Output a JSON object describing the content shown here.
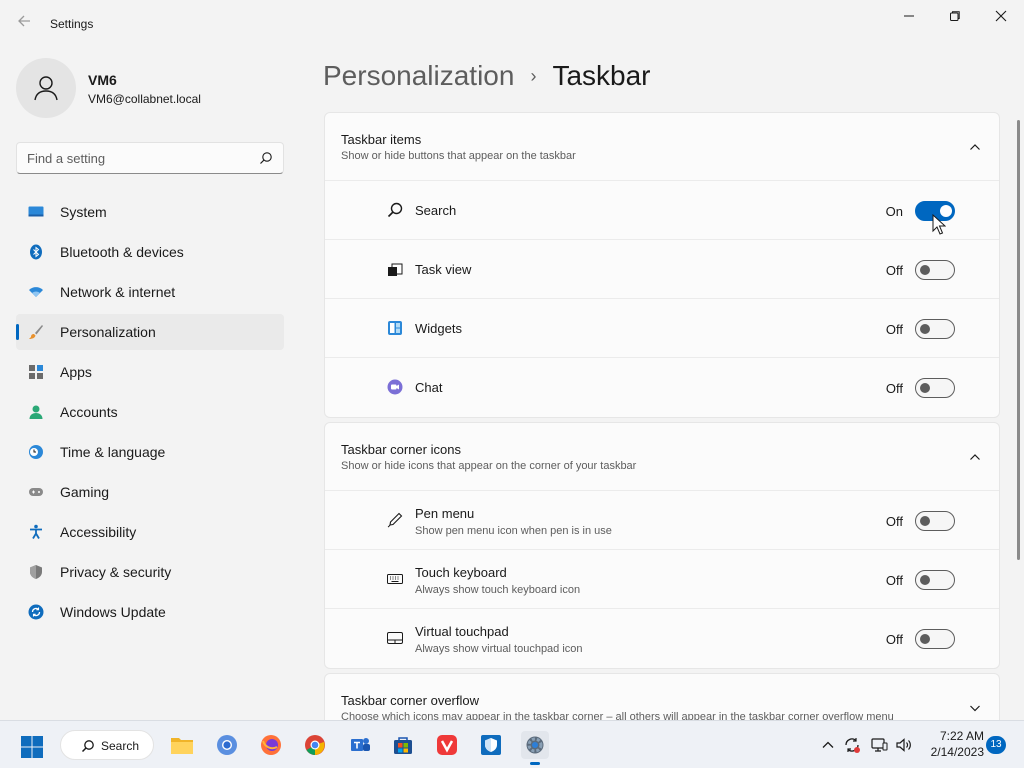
{
  "window": {
    "title": "Settings"
  },
  "user": {
    "name": "VM6",
    "email": "VM6@collabnet.local"
  },
  "search": {
    "placeholder": "Find a setting"
  },
  "sidebar": {
    "items": [
      {
        "label": "System",
        "icon": "monitor-icon"
      },
      {
        "label": "Bluetooth & devices",
        "icon": "bluetooth-icon"
      },
      {
        "label": "Network & internet",
        "icon": "wifi-icon"
      },
      {
        "label": "Personalization",
        "icon": "brush-icon",
        "selected": true
      },
      {
        "label": "Apps",
        "icon": "apps-icon"
      },
      {
        "label": "Accounts",
        "icon": "accounts-icon"
      },
      {
        "label": "Time & language",
        "icon": "clock-globe-icon"
      },
      {
        "label": "Gaming",
        "icon": "gamepad-icon"
      },
      {
        "label": "Accessibility",
        "icon": "accessibility-icon"
      },
      {
        "label": "Privacy & security",
        "icon": "shield-icon"
      },
      {
        "label": "Windows Update",
        "icon": "update-icon"
      }
    ]
  },
  "breadcrumb": {
    "parent": "Personalization",
    "separator": "›",
    "current": "Taskbar"
  },
  "sections": {
    "taskbar_items": {
      "title": "Taskbar items",
      "description": "Show or hide buttons that appear on the taskbar",
      "rows": [
        {
          "label": "Search",
          "state": "On",
          "on": true,
          "icon": "search-icon"
        },
        {
          "label": "Task view",
          "state": "Off",
          "on": false,
          "icon": "task-view-icon"
        },
        {
          "label": "Widgets",
          "state": "Off",
          "on": false,
          "icon": "widgets-icon"
        },
        {
          "label": "Chat",
          "state": "Off",
          "on": false,
          "icon": "chat-icon"
        }
      ]
    },
    "corner_icons": {
      "title": "Taskbar corner icons",
      "description": "Show or hide icons that appear on the corner of your taskbar",
      "rows": [
        {
          "label": "Pen menu",
          "sub": "Show pen menu icon when pen is in use",
          "state": "Off",
          "on": false,
          "icon": "pen-icon"
        },
        {
          "label": "Touch keyboard",
          "sub": "Always show touch keyboard icon",
          "state": "Off",
          "on": false,
          "icon": "keyboard-icon"
        },
        {
          "label": "Virtual touchpad",
          "sub": "Always show virtual touchpad icon",
          "state": "Off",
          "on": false,
          "icon": "touchpad-icon"
        }
      ]
    },
    "corner_overflow": {
      "title": "Taskbar corner overflow",
      "description": "Choose which icons may appear in the taskbar corner – all others will appear in the taskbar corner overflow menu"
    }
  },
  "taskbar": {
    "search_label": "Search",
    "apps": [
      "file-explorer-icon",
      "chromium-icon",
      "firefox-icon",
      "chrome-icon",
      "teams-icon",
      "store-icon",
      "vivaldi-icon",
      "defender-icon",
      "settings-icon"
    ],
    "time": "7:22 AM",
    "date": "2/14/2023",
    "notification_count": "13"
  },
  "colors": {
    "accent": "#0067c0",
    "background": "#f3f3f3",
    "card": "#fbfbfb"
  }
}
